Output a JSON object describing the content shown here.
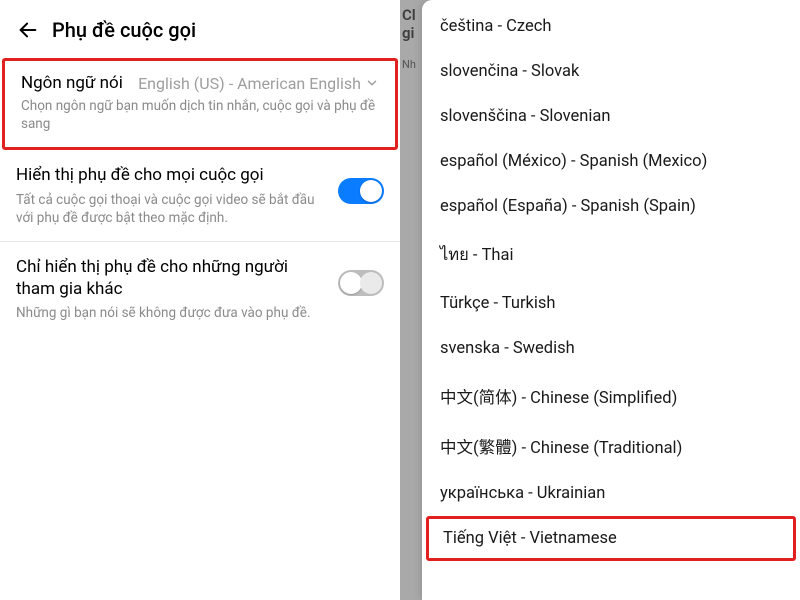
{
  "left": {
    "header_title": "Phụ đề cuộc gọi",
    "spoken_lang": {
      "label": "Ngôn ngữ nói",
      "value": "English (US) - American English",
      "desc": "Chọn ngôn ngữ bạn muốn dịch tin nhắn, cuộc gọi và phụ đề sang"
    },
    "show_all": {
      "title": "Hiển thị phụ đề cho mọi cuộc gọi",
      "desc": "Tất cả cuộc gọi thoại và cuộc gọi video sẽ bắt đầu với phụ đề được bật theo mặc định.",
      "on": true
    },
    "only_others": {
      "title": "Chỉ hiển thị phụ đề cho những người tham gia khác",
      "desc": "Những gì bạn nói sẽ không được đưa vào phụ đề.",
      "on": false
    }
  },
  "right": {
    "bg_title_l1": "Cl",
    "bg_title_l2": "gi",
    "bg_sub": "Nh",
    "languages": [
      "čeština - Czech",
      "slovenčina - Slovak",
      "slovenščina - Slovenian",
      "español (México) - Spanish (Mexico)",
      "español (España) - Spanish (Spain)",
      "ไทย - Thai",
      "Türkçe - Turkish",
      "svenska - Swedish",
      "中文(简体) - Chinese (Simplified)",
      "中文(繁體) - Chinese (Traditional)",
      "українська - Ukrainian",
      "Tiếng Việt - Vietnamese"
    ],
    "highlight_index": 11
  }
}
